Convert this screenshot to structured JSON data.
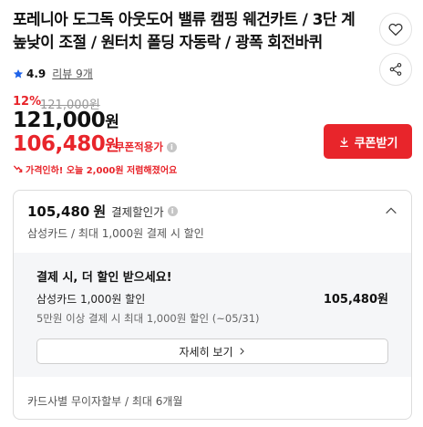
{
  "product": {
    "title": "포레니아 도그독 아웃도어 밸류 캠핑 웨건카트 / 3단 계 높낮이 조절 / 원터치 폴딩 자동락 / 광폭 회전바퀴",
    "rating": "4.9",
    "review_label": "리뷰 9개"
  },
  "actions": {
    "like_icon": "heart-icon",
    "share_icon": "share-icon"
  },
  "price": {
    "discount_rate": "12%",
    "original": "121,000원",
    "sale": "121,000",
    "sale_unit": "원",
    "coupon_price": "106,480",
    "coupon_unit": "원",
    "coupon_label": "쿠폰적용가",
    "drop_notice": "가격인하! 오늘 2,000원 저렴해졌어요"
  },
  "coupon_button": {
    "label": "쿠폰받기"
  },
  "benefit": {
    "price": "105,480",
    "unit": "원",
    "label": "결제할인가",
    "sub": "삼성카드 / 최대 1,000원 결제 시 할인",
    "panel": {
      "title": "결제 시, 더 할인 받으세요!",
      "card_line": "삼성카드 1,000원 할인",
      "amount": "105,480",
      "amount_unit": "원",
      "condition": "5만원 이상 결제 시 최대 1,000원 할인 (~05/31)",
      "detail_button": "자세히 보기"
    },
    "installment": "카드사별 무이자할부 / 최대 6개월"
  },
  "colors": {
    "accent": "#e8252b",
    "star": "#1e63e9"
  }
}
